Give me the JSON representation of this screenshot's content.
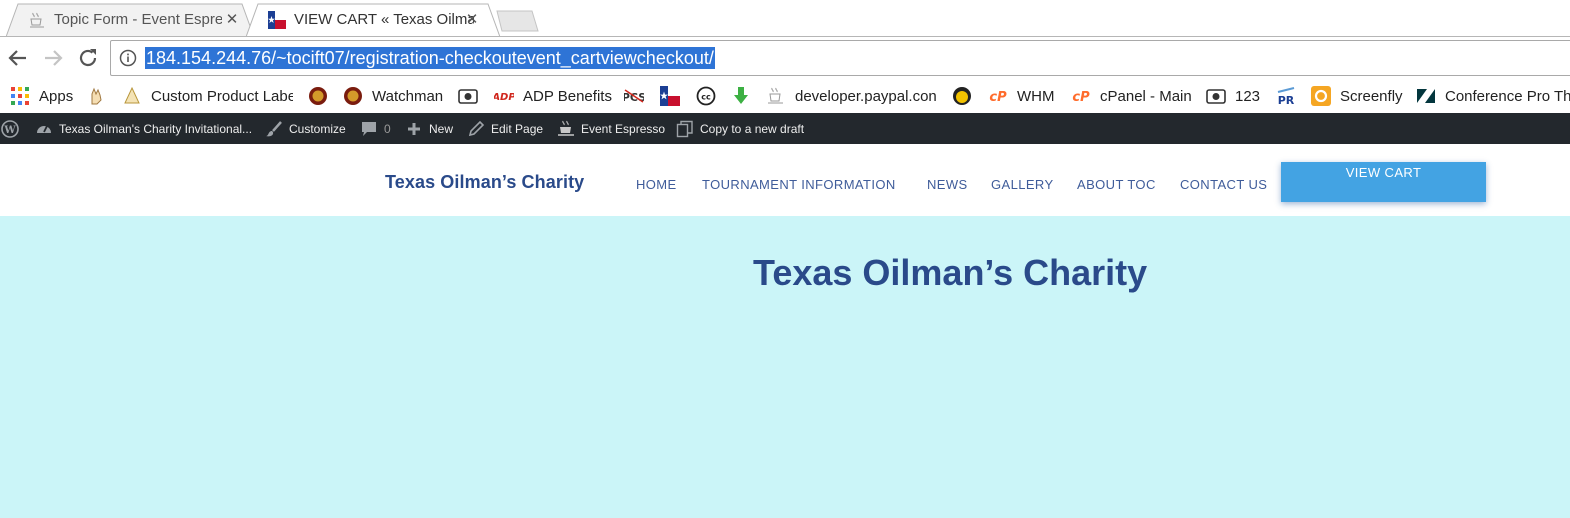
{
  "tabs": [
    {
      "title": "Topic Form - Event Espre",
      "icon": "coffee-cup-icon",
      "active": false
    },
    {
      "title": "VIEW CART « Texas Oilma",
      "icon": "texas-flag-icon",
      "active": true
    }
  ],
  "address_bar": {
    "url": "184.154.244.76/~tocift07/registration-checkoutevent_cartviewcheckout/"
  },
  "bookmarks": [
    {
      "label": "Apps",
      "icon": "apps-grid-icon"
    },
    {
      "label": "",
      "icon": "hand-icon"
    },
    {
      "label": "Custom Product Labe",
      "icon": "cone-icon"
    },
    {
      "label": "",
      "icon": "seal-icon"
    },
    {
      "label": "Watchman",
      "icon": "seal-icon"
    },
    {
      "label": "",
      "icon": "camera-icon"
    },
    {
      "label": "ADP Benefits",
      "icon": "adp-logo-icon"
    },
    {
      "label": "",
      "icon": "pcs-logo-icon"
    },
    {
      "label": "",
      "icon": "texas-flag-icon"
    },
    {
      "label": "",
      "icon": "creative-commons-icon"
    },
    {
      "label": "",
      "icon": "download-arrow-icon"
    },
    {
      "label": "developer.paypal.con",
      "icon": "coffee-cup-icon"
    },
    {
      "label": "",
      "icon": "face-icon"
    },
    {
      "label": "WHM",
      "icon": "cpanel-icon"
    },
    {
      "label": "cPanel - Main",
      "icon": "cpanel-icon"
    },
    {
      "label": "123",
      "icon": "camera-icon"
    },
    {
      "label": "",
      "icon": "pr-logo-icon"
    },
    {
      "label": "Screenfly",
      "icon": "screenfly-icon"
    },
    {
      "label": "Conference Pro Th",
      "icon": "zendesk-icon"
    }
  ],
  "admin_bar": {
    "site_name": "Texas Oilman's Charity Invitational...",
    "customize": "Customize",
    "comments_count": "0",
    "new": "New",
    "edit_page": "Edit Page",
    "event_espresso": "Event Espresso",
    "copy_draft": "Copy to a new draft"
  },
  "site": {
    "logo": "Texas Oilman’s Charity",
    "nav": [
      "HOME",
      "TOURNAMENT INFORMATION",
      "NEWS",
      "GALLERY",
      "ABOUT TOC",
      "CONTACT US"
    ],
    "cart_button": "VIEW CART"
  },
  "hero": {
    "title": "Texas Oilman’s Charity"
  },
  "colors": {
    "admin_bar": "#23282d",
    "brand_blue": "#2a4a8a",
    "cart_button": "#43a3e3",
    "hero_bg": "#cbf5f8",
    "url_highlight": "#2e74d6"
  }
}
